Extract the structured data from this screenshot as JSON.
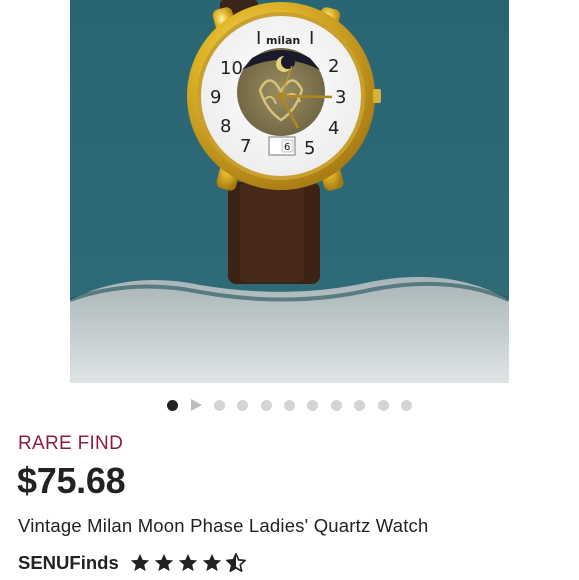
{
  "listing": {
    "image_alt": "Vintage Milan Moon Phase Ladies' Quartz Watch",
    "watch_brand_mark": "milan",
    "dial_numbers": [
      "10",
      "2",
      "3",
      "9",
      "8",
      "4",
      "7",
      "5"
    ],
    "date_window": "6",
    "gallery": {
      "total_slides": 11,
      "current_slide": 1,
      "video_slide": 2
    },
    "badge": "RARE FIND",
    "price": "$75.68",
    "title": "Vintage Milan Moon Phase Ladies' Quartz Watch",
    "shop_name": "SENUFinds",
    "rating": 4.5,
    "colors": {
      "badge": "#8c1d3e",
      "text": "#222222",
      "star": "#222222",
      "dot_active": "#222222",
      "dot_inactive": "#d4d4d4",
      "pillow": "#2d6672"
    }
  }
}
